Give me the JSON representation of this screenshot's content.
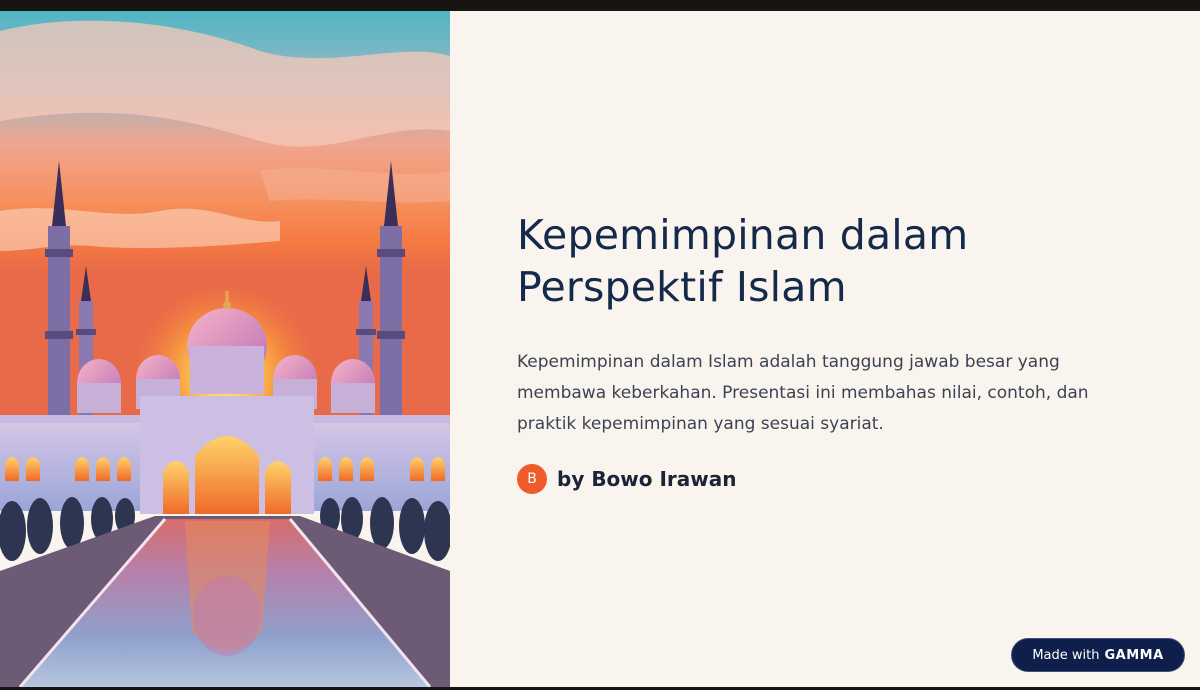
{
  "slide": {
    "title_line1": "Kepemimpinan dalam",
    "title_line2": "Perspektif Islam",
    "description": "Kepemimpinan dalam Islam adalah tanggung jawab besar yang membawa keberkahan. Presentasi ini membahas nilai, contoh, dan praktik kepemimpinan yang sesuai syariat.",
    "author": {
      "initial": "B",
      "name": "by Bowo Irawan"
    }
  },
  "badge": {
    "prefix": "Made with",
    "brand": "GAMMA"
  },
  "colors": {
    "slide_background": "#f9f5ee",
    "title": "#15294a",
    "avatar": "#ef5b2a",
    "badge_background": "#0d1f4a"
  }
}
